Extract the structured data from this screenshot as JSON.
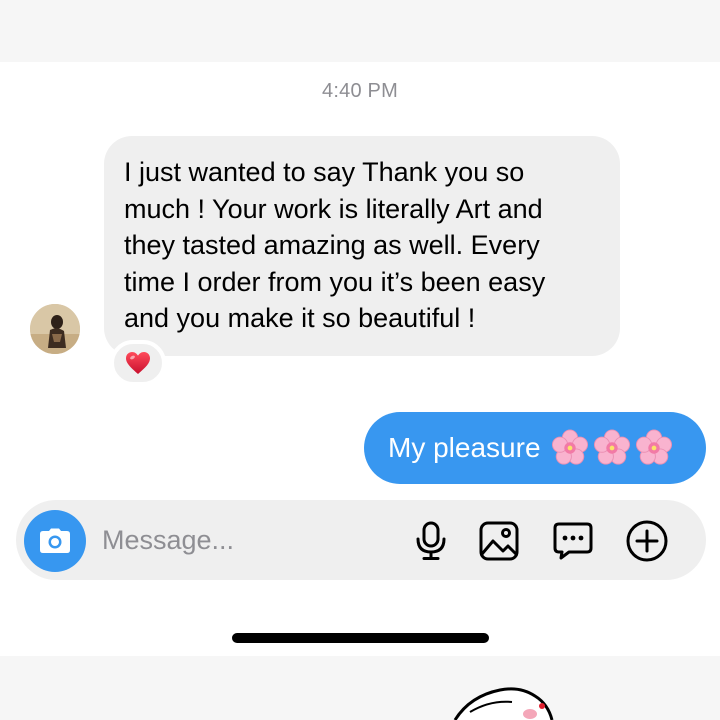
{
  "thread": {
    "timestamp": "4:40 PM",
    "incoming": {
      "text": "I just wanted to say Thank you so\nmuch ! Your work is literally Art and\nthey tasted amazing as well. Every\ntime I order from you it’s been easy\nand you make it so beautiful !",
      "reaction_icon": "red-heart-icon"
    },
    "outgoing": {
      "text": "My pleasure",
      "emoji_icons": [
        "cherry-blossom-icon",
        "cherry-blossom-icon",
        "cherry-blossom-icon"
      ]
    }
  },
  "composer": {
    "placeholder": "Message...",
    "icons": [
      "camera-icon",
      "microphone-icon",
      "gallery-icon",
      "sticker-chat-icon",
      "plus-icon"
    ]
  },
  "colors": {
    "accent_blue": "#3797f0",
    "incoming_bubble": "#efefef",
    "timestamp_gray": "#8e8e93",
    "heart_red": "#e0202f",
    "blossom_pink": "#f7a8c8"
  }
}
